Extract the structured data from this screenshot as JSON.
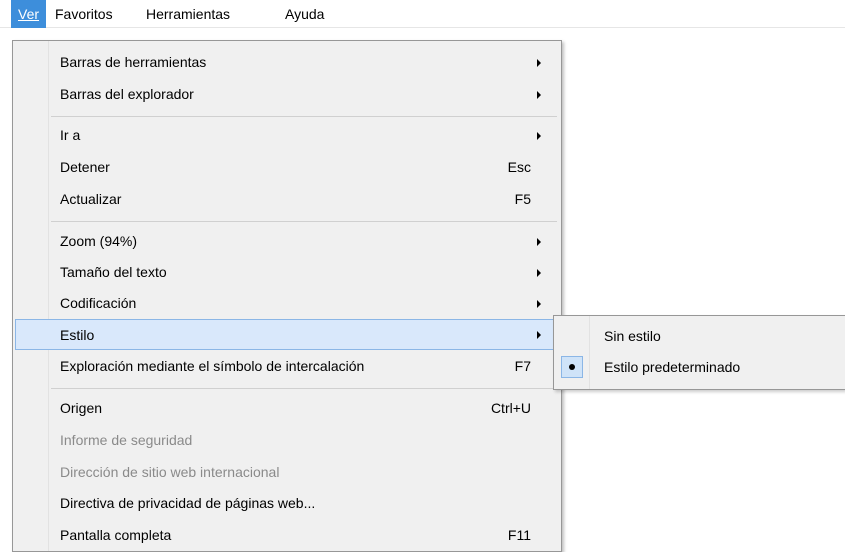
{
  "menubar": {
    "ver": "Ver",
    "favoritos": "Favoritos",
    "herramientas": "Herramientas",
    "ayuda": "Ayuda"
  },
  "menu": {
    "barras_herramientas": "Barras de herramientas",
    "barras_explorador": "Barras del explorador",
    "ir_a": "Ir a",
    "detener": "Detener",
    "detener_sc": "Esc",
    "actualizar": "Actualizar",
    "actualizar_sc": "F5",
    "zoom": "Zoom (94%)",
    "tamano_texto": "Tamaño del texto",
    "codificacion": "Codificación",
    "estilo": "Estilo",
    "exploracion": "Exploración mediante el símbolo de intercalación",
    "exploracion_sc": "F7",
    "origen": "Origen",
    "origen_sc": "Ctrl+U",
    "informe_seguridad": "Informe de seguridad",
    "direccion_sitio": "Dirección de sitio web internacional",
    "directiva_privacidad": "Directiva de privacidad de páginas web...",
    "pantalla_completa": "Pantalla completa",
    "pantalla_completa_sc": "F11"
  },
  "submenu": {
    "sin_estilo": "Sin estilo",
    "estilo_predeterminado": "Estilo predeterminado",
    "checked_item": "estilo_predeterminado"
  },
  "colors": {
    "menubar_active": "#3d8edb",
    "highlight_fill": "#d9e8fb",
    "highlight_border": "#8bb6e6",
    "menu_bg": "#f0f0f0",
    "disabled_text": "#8a8a8a"
  }
}
